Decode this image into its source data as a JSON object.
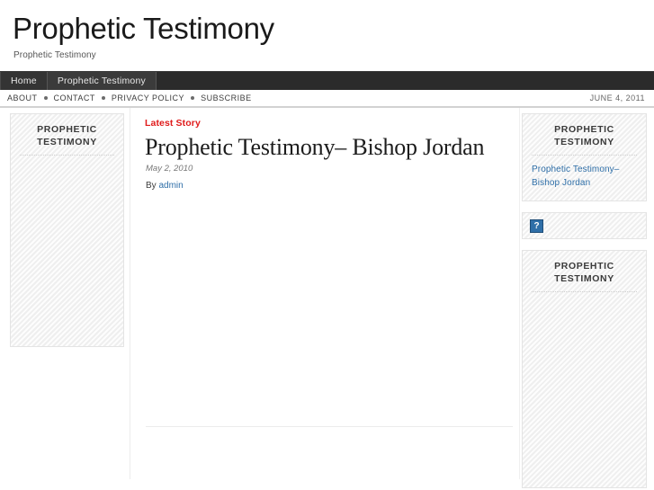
{
  "site": {
    "title": "Prophetic Testimony",
    "tagline": "Prophetic Testimony"
  },
  "nav_primary": {
    "items": [
      {
        "label": "Home",
        "active": false
      },
      {
        "label": "Prophetic Testimony",
        "active": true
      }
    ]
  },
  "nav_secondary": {
    "links": [
      "ABOUT",
      "CONTACT",
      "PRIVACY POLICY",
      "SUBSCRIBE"
    ],
    "date": "JUNE 4, 2011"
  },
  "sidebar_left": {
    "widget": {
      "title": "PROPHETIC TESTIMONY",
      "body": ""
    }
  },
  "main": {
    "kicker": "Latest Story",
    "post_title": "Prophetic Testimony– Bishop Jordan",
    "post_date": "May 2, 2010",
    "byline_prefix": "By",
    "byline_author": "admin",
    "body": ""
  },
  "sidebar_right": {
    "widget_recent": {
      "title": "PROPHETIC TESTIMONY",
      "links": [
        "Prophetic Testimony– Bishop Jordan"
      ]
    },
    "widget_image": {
      "icon": "broken-image-icon",
      "alt": "?"
    },
    "widget_second": {
      "title": "PROPEHTIC TESTIMONY",
      "body": ""
    }
  },
  "colors": {
    "accent_red": "#e01b1b",
    "link_blue": "#2f6fa8",
    "nav_dark": "#2b2b2b",
    "widget_bg": "#f6f6f6"
  }
}
